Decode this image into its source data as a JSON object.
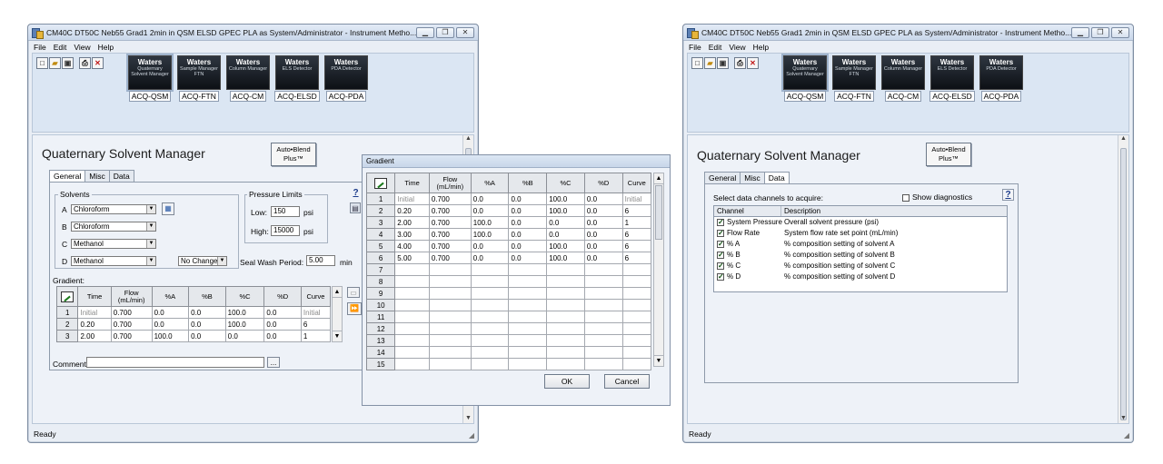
{
  "window1": {
    "title": "CM40C DT50C Neb55 Grad1 2min in QSM ELSD GPEC PLA as System/Administrator - Instrument Metho...",
    "menu": [
      "File",
      "Edit",
      "View",
      "Help"
    ],
    "modules": [
      {
        "brand": "Waters",
        "name": "Quaternary Solvent Manager",
        "label": "ACQ-QSM"
      },
      {
        "brand": "Waters",
        "name": "Sample Manager FTN",
        "label": "ACQ-FTN"
      },
      {
        "brand": "Waters",
        "name": "Column Manager",
        "label": "ACQ-CM"
      },
      {
        "brand": "Waters",
        "name": "ELS Detector",
        "label": "ACQ-ELSD"
      },
      {
        "brand": "Waters",
        "name": "PDA Detector",
        "label": "ACQ-PDA"
      }
    ],
    "heading": "Quaternary Solvent Manager",
    "autoblend": {
      "line1": "Auto•Blend",
      "line2": "Plus™"
    },
    "tabs": [
      "General",
      "Misc",
      "Data"
    ],
    "solvents_label": "Solvents",
    "solvents": [
      {
        "letter": "A",
        "value": "Chloroform"
      },
      {
        "letter": "B",
        "value": "Chloroform"
      },
      {
        "letter": "C",
        "value": "Methanol"
      },
      {
        "letter": "D",
        "value": "Methanol"
      }
    ],
    "no_change": "No Change",
    "pressure_limits_label": "Pressure Limits",
    "low_label": "Low:",
    "low_value": "150",
    "high_label": "High:",
    "high_value": "15000",
    "psi": "psi",
    "seal_wash_label": "Seal Wash Period:",
    "seal_wash_value": "5.00",
    "min": "min",
    "help": "?",
    "gradient_label": "Gradient:",
    "comment_label": "Comment:",
    "comment_value": "",
    "ellipsis": "...",
    "status": "Ready"
  },
  "gradient_headers": [
    "Time",
    "Flow (mL/min)",
    "%A",
    "%B",
    "%C",
    "%D",
    "Curve"
  ],
  "gradient_rows": [
    {
      "n": "1",
      "time": "Initial",
      "flow": "0.700",
      "a": "0.0",
      "b": "0.0",
      "c": "100.0",
      "d": "0.0",
      "curve": "Initial"
    },
    {
      "n": "2",
      "time": "0.20",
      "flow": "0.700",
      "a": "0.0",
      "b": "0.0",
      "c": "100.0",
      "d": "0.0",
      "curve": "6"
    },
    {
      "n": "3",
      "time": "2.00",
      "flow": "0.700",
      "a": "100.0",
      "b": "0.0",
      "c": "0.0",
      "d": "0.0",
      "curve": "1"
    },
    {
      "n": "4",
      "time": "3.00",
      "flow": "0.700",
      "a": "100.0",
      "b": "0.0",
      "c": "0.0",
      "d": "0.0",
      "curve": "6"
    },
    {
      "n": "5",
      "time": "4.00",
      "flow": "0.700",
      "a": "0.0",
      "b": "0.0",
      "c": "100.0",
      "d": "0.0",
      "curve": "6"
    },
    {
      "n": "6",
      "time": "5.00",
      "flow": "0.700",
      "a": "0.0",
      "b": "0.0",
      "c": "100.0",
      "d": "0.0",
      "curve": "6"
    }
  ],
  "popup": {
    "title": "Gradient",
    "empty_rows": [
      "7",
      "8",
      "9",
      "10",
      "11",
      "12",
      "13",
      "14",
      "15"
    ],
    "ok": "OK",
    "cancel": "Cancel"
  },
  "window2": {
    "title": "CM40C DT50C Neb55 Grad1 2min in QSM ELSD GPEC PLA as System/Administrator - Instrument Metho...",
    "menu": [
      "File",
      "Edit",
      "View",
      "Help"
    ],
    "heading": "Quaternary Solvent Manager",
    "tabs": [
      "General",
      "Misc",
      "Data"
    ],
    "select_label": "Select data channels to acquire:",
    "show_diagnostics": "Show diagnostics",
    "help": "?",
    "channel_header": "Channel",
    "description_header": "Description",
    "channels": [
      {
        "name": "System Pressure",
        "desc": "Overall solvent pressure (psi)"
      },
      {
        "name": "Flow Rate",
        "desc": "System flow rate set point (mL/min)"
      },
      {
        "name": "% A",
        "desc": "% composition setting of solvent A"
      },
      {
        "name": "% B",
        "desc": "% composition setting of solvent B"
      },
      {
        "name": "% C",
        "desc": "% composition setting of solvent C"
      },
      {
        "name": "% D",
        "desc": "% composition setting of solvent D"
      }
    ],
    "status": "Ready"
  }
}
